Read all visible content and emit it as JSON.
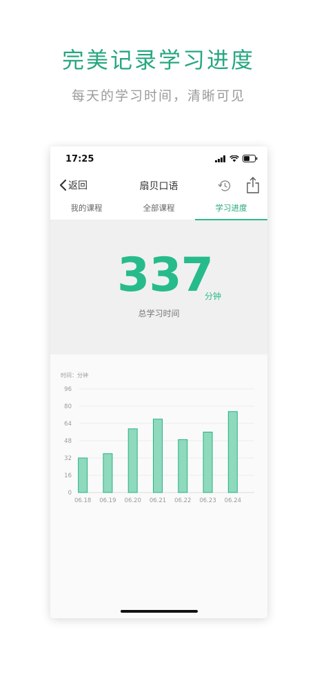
{
  "promo": {
    "title": "完美记录学习进度",
    "subtitle": "每天的学习时间，清晰可见"
  },
  "status_bar": {
    "time": "17:25"
  },
  "nav": {
    "back_label": "返回",
    "title": "扇贝口语"
  },
  "tabs": [
    {
      "label": "我的课程",
      "active": false
    },
    {
      "label": "全部课程",
      "active": false
    },
    {
      "label": "学习进度",
      "active": true
    }
  ],
  "summary": {
    "total": "337",
    "unit": "分钟",
    "label": "总学习时间"
  },
  "colors": {
    "accent": "#27bb8c",
    "bar_fill": "#8fd9bd",
    "bar_stroke": "#27b187"
  },
  "chart_data": {
    "type": "bar",
    "title": "",
    "unit_label": "时间：分钟",
    "xlabel": "",
    "ylabel": "",
    "categories": [
      "06.18",
      "06.19",
      "06.20",
      "06.21",
      "06.22",
      "06.23",
      "06.24"
    ],
    "values": [
      32,
      36,
      59,
      68,
      49,
      56,
      75
    ],
    "yticks": [
      0,
      16,
      32,
      48,
      64,
      80,
      96
    ],
    "ylim": [
      0,
      96
    ],
    "grid": true
  }
}
